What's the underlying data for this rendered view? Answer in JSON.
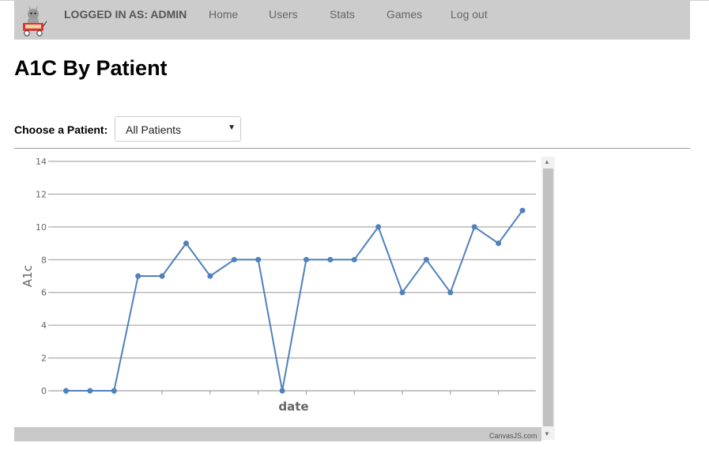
{
  "header": {
    "logged_in": "LOGGED IN AS: ADMIN",
    "nav": [
      "Home",
      "Users",
      "Stats",
      "Games",
      "Log out"
    ]
  },
  "page_title": "A1C By Patient",
  "patient_select": {
    "label": "Choose a Patient:",
    "value": "All Patients"
  },
  "chart_credit": "CanvasJS.com",
  "chart_data": {
    "type": "line",
    "xlabel": "date",
    "ylabel": "A1c",
    "ylim": [
      0,
      14
    ],
    "yticks": [
      0,
      2,
      4,
      6,
      8,
      10,
      12,
      14
    ],
    "grid": true,
    "line_color": "#4f81bc",
    "series": [
      {
        "values": [
          0,
          0,
          0,
          7,
          7,
          9,
          7,
          8,
          8,
          0,
          8,
          8,
          8,
          10,
          6,
          8,
          6,
          10,
          9,
          11
        ]
      }
    ]
  }
}
